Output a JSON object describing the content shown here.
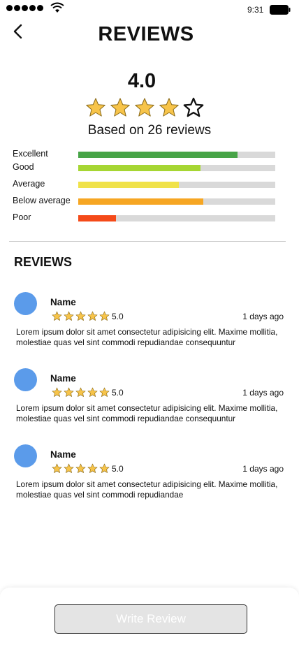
{
  "status_bar": {
    "time": "9:31"
  },
  "header": {
    "title": "REVIEWS"
  },
  "summary": {
    "score": "4.0",
    "stars": 4,
    "max_stars": 5,
    "based_on": "Based on 26 reviews"
  },
  "breakdown": [
    {
      "label": "Excellent",
      "fraction": 0.81,
      "color": "#47a447"
    },
    {
      "label": "Good",
      "fraction": 0.62,
      "color": "#a6d633"
    },
    {
      "label": "Average",
      "fraction": 0.51,
      "color": "#f0e24a"
    },
    {
      "label": "Below average",
      "fraction": 0.635,
      "color": "#f6a623"
    },
    {
      "label": "Poor",
      "fraction": 0.19,
      "color": "#f44a19"
    }
  ],
  "reviews_section": {
    "title": "REVIEWS"
  },
  "reviews": [
    {
      "name": "Name",
      "rating": "5.0",
      "date": "1 days ago",
      "text": "Lorem ipsum dolor sit amet consectetur adipisicing elit. Maxime mollitia, molestiae quas vel sint commodi repudiandae consequuntur"
    },
    {
      "name": "Name",
      "rating": "5.0",
      "date": "1 days ago",
      "text": "Lorem ipsum dolor sit amet consectetur adipisicing elit. Maxime mollitia, molestiae quas vel sint commodi repudiandae consequuntur"
    },
    {
      "name": "Name",
      "rating": "5.0",
      "date": "1 days ago",
      "text": "Lorem ipsum dolor sit amet consectetur adipisicing elit. Maxime mollitia, molestiae quas vel sint commodi repudiandae"
    }
  ],
  "footer": {
    "write_review_label": "Write Review"
  },
  "colors": {
    "star_fill": "#f7c44a",
    "avatar": "#5b9bea"
  },
  "icons": [
    "signal-icon",
    "wifi-icon",
    "battery-icon",
    "back-arrow-icon",
    "star-icon"
  ]
}
